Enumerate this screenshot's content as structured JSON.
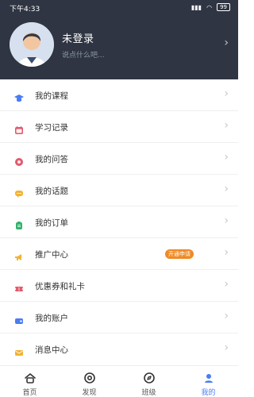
{
  "status": {
    "time": "下午4:33",
    "battery": "99"
  },
  "profile": {
    "name": "未登录",
    "subtitle": "说点什么吧..."
  },
  "menu": {
    "items": [
      {
        "label": "我的课程"
      },
      {
        "label": "学习记录"
      },
      {
        "label": "我的问答"
      },
      {
        "label": "我的话题"
      },
      {
        "label": "我的订单"
      },
      {
        "label": "推广中心",
        "tag": "开通申请"
      },
      {
        "label": "优惠券和礼卡"
      },
      {
        "label": "我的账户"
      },
      {
        "label": "消息中心"
      }
    ]
  },
  "nav": {
    "items": [
      {
        "label": "首页"
      },
      {
        "label": "发现"
      },
      {
        "label": "班级"
      },
      {
        "label": "我的"
      }
    ]
  },
  "colors": {
    "header_bg": "#2f3542",
    "accent_blue": "#4a7cf3",
    "tag_orange": "#f08a24"
  }
}
